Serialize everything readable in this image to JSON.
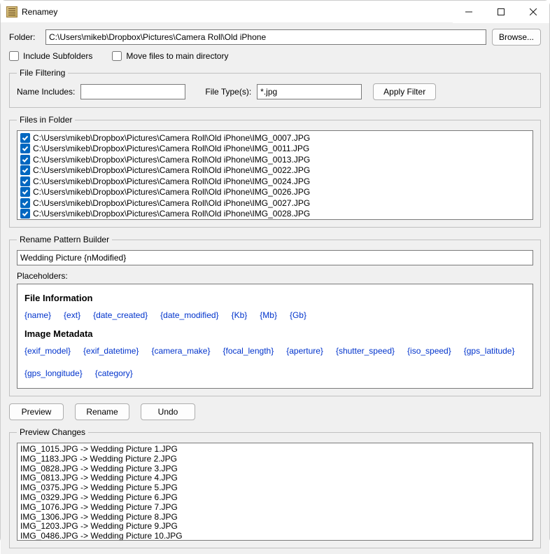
{
  "window": {
    "title": "Renamey"
  },
  "folder_row": {
    "label": "Folder:",
    "path": "C:\\Users\\mikeb\\Dropbox\\Pictures\\Camera Roll\\Old iPhone",
    "browse_label": "Browse..."
  },
  "options": {
    "include_subfolders_label": "Include Subfolders",
    "move_files_label": "Move files to main directory"
  },
  "file_filtering": {
    "legend": "File Filtering",
    "name_includes_label": "Name Includes:",
    "name_includes_value": "",
    "file_types_label": "File Type(s):",
    "file_types_value": "*.jpg",
    "apply_label": "Apply Filter"
  },
  "files_in_folder": {
    "legend": "Files in Folder",
    "items": [
      "C:\\Users\\mikeb\\Dropbox\\Pictures\\Camera Roll\\Old iPhone\\IMG_0007.JPG",
      "C:\\Users\\mikeb\\Dropbox\\Pictures\\Camera Roll\\Old iPhone\\IMG_0011.JPG",
      "C:\\Users\\mikeb\\Dropbox\\Pictures\\Camera Roll\\Old iPhone\\IMG_0013.JPG",
      "C:\\Users\\mikeb\\Dropbox\\Pictures\\Camera Roll\\Old iPhone\\IMG_0022.JPG",
      "C:\\Users\\mikeb\\Dropbox\\Pictures\\Camera Roll\\Old iPhone\\IMG_0024.JPG",
      "C:\\Users\\mikeb\\Dropbox\\Pictures\\Camera Roll\\Old iPhone\\IMG_0026.JPG",
      "C:\\Users\\mikeb\\Dropbox\\Pictures\\Camera Roll\\Old iPhone\\IMG_0027.JPG",
      "C:\\Users\\mikeb\\Dropbox\\Pictures\\Camera Roll\\Old iPhone\\IMG_0028.JPG"
    ]
  },
  "rename_pattern": {
    "legend": "Rename Pattern Builder",
    "value": "Wedding Picture {nModified}",
    "placeholders_label": "Placeholders:",
    "file_info_heading": "File Information",
    "file_info_items": [
      "{name}",
      "{ext}",
      "{date_created}",
      "{date_modified}",
      "{Kb}",
      "{Mb}",
      "{Gb}"
    ],
    "image_meta_heading": "Image Metadata",
    "image_meta_items": [
      "{exif_model}",
      "{exif_datetime}",
      "{camera_make}",
      "{focal_length}",
      "{aperture}",
      "{shutter_speed}",
      "{iso_speed}",
      "{gps_latitude}",
      "{gps_longitude}",
      "{category}"
    ]
  },
  "actions": {
    "preview_label": "Preview",
    "rename_label": "Rename",
    "undo_label": "Undo"
  },
  "preview_changes": {
    "legend": "Preview Changes",
    "items": [
      "IMG_1015.JPG -> Wedding Picture 1.JPG",
      "IMG_1183.JPG -> Wedding Picture 2.JPG",
      "IMG_0828.JPG -> Wedding Picture 3.JPG",
      "IMG_0813.JPG -> Wedding Picture 4.JPG",
      "IMG_0375.JPG -> Wedding Picture 5.JPG",
      "IMG_0329.JPG -> Wedding Picture 6.JPG",
      "IMG_1076.JPG -> Wedding Picture 7.JPG",
      "IMG_1306.JPG -> Wedding Picture 8.JPG",
      "IMG_1203.JPG -> Wedding Picture 9.JPG",
      "IMG_0486.JPG -> Wedding Picture 10.JPG"
    ]
  }
}
